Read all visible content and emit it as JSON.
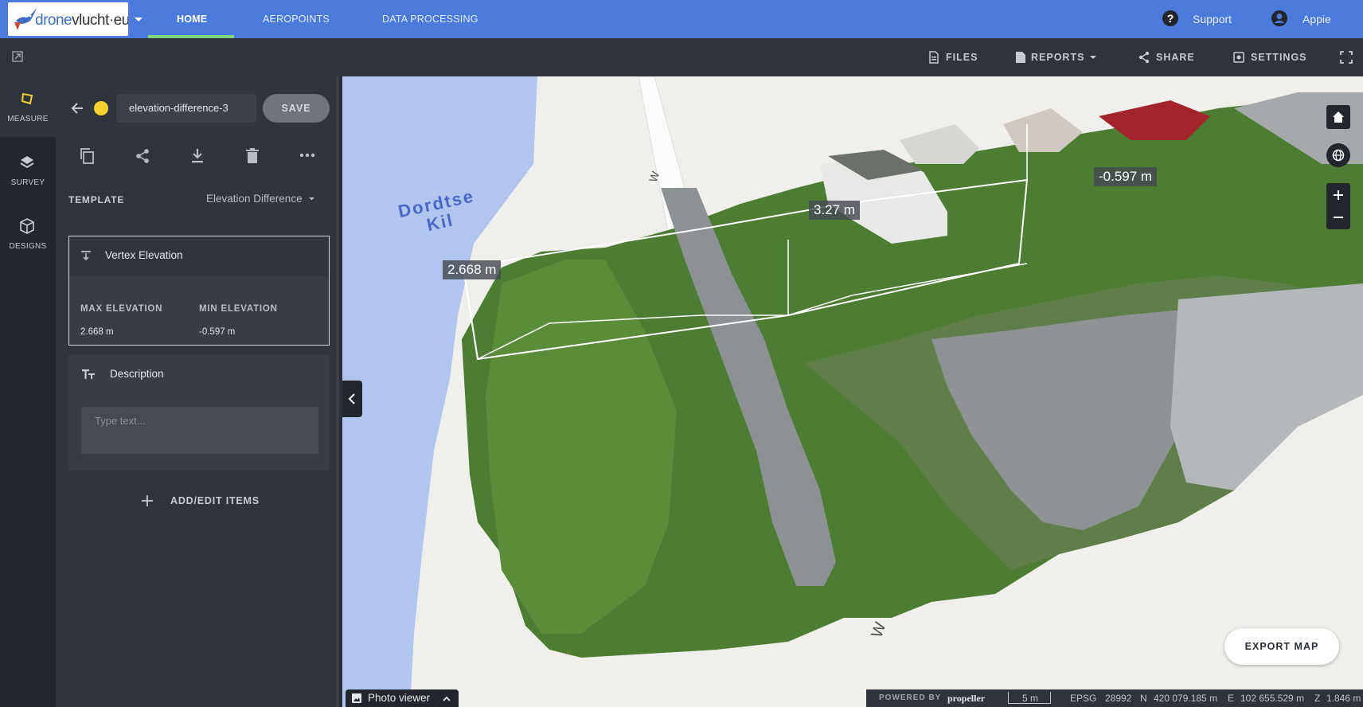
{
  "brand": {
    "logo_text_a": "drone",
    "logo_text_b": "vlucht",
    "logo_text_c": "·eu"
  },
  "nav": {
    "home": "HOME",
    "aeropoints": "AEROPOINTS",
    "data_processing": "DATA PROCESSING"
  },
  "top_right": {
    "support": "Support",
    "user": "Appie"
  },
  "toolbar": {
    "files": "FILES",
    "reports": "REPORTS",
    "share": "SHARE",
    "settings": "SETTINGS"
  },
  "rail": {
    "measure": "MEASURE",
    "survey": "SURVEY",
    "designs": "DESIGNS"
  },
  "measurement": {
    "name": "elevation-difference-3",
    "save": "SAVE",
    "color": "#f3d22d",
    "template_label": "TEMPLATE",
    "template_value": "Elevation Difference",
    "vertex_title": "Vertex Elevation",
    "max_label": "MAX ELEVATION",
    "max_value": "2.668 m",
    "min_label": "MIN ELEVATION",
    "min_value": "-0.597 m",
    "description_title": "Description",
    "description_placeholder": "Type text...",
    "add_items": "ADD/EDIT ITEMS"
  },
  "map": {
    "water_label_1": "Dordtse",
    "water_label_2": "Kil",
    "label_a": "2.668 m",
    "label_b": "3.27 m",
    "label_c": "-0.597 m",
    "road_marker_top": "W",
    "road_marker_bottom": "W",
    "export": "EXPORT MAP",
    "photo_viewer": "Photo viewer"
  },
  "status": {
    "powered_by": "POWERED BY",
    "propeller": "propeller",
    "scale": "5 m",
    "epsg_label": "EPSG",
    "epsg_code": "28992",
    "n_label": "N",
    "n_value": "420 079.185 m",
    "e_label": "E",
    "e_value": "102 655.529 m",
    "z_label": "Z",
    "z_value": "1.846 m"
  }
}
